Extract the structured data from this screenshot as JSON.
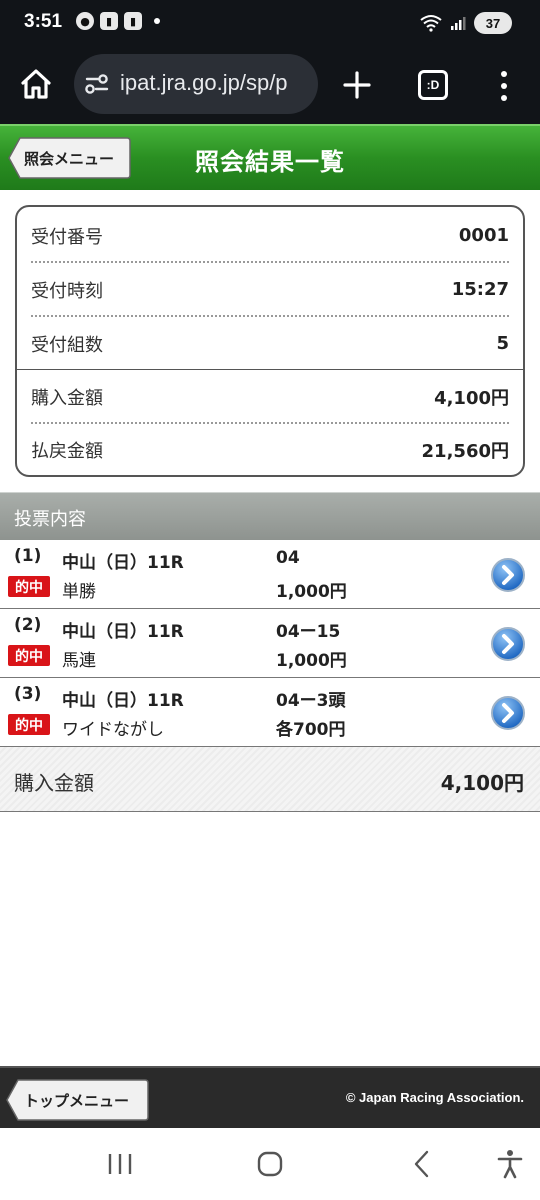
{
  "status_bar": {
    "time": "3:51",
    "battery": "37",
    "notification_icons": [
      "notification-icon",
      "twitch-icon",
      "twitch-icon"
    ]
  },
  "browser": {
    "url": "ipat.jra.go.jp/sp/p",
    "tabs_label": ":D"
  },
  "header": {
    "back_button": "照会メニュー",
    "title": "照会結果一覧",
    "accent_color": "#2a8f22"
  },
  "summary": {
    "rows": [
      {
        "label": "受付番号",
        "value": "0001"
      },
      {
        "label": "受付時刻",
        "value": "15:27"
      },
      {
        "label": "受付組数",
        "value": "5"
      },
      {
        "label": "購入金額",
        "value": "4,100円"
      },
      {
        "label": "払戻金額",
        "value": "21,560円"
      }
    ]
  },
  "votes": {
    "section_title": "投票内容",
    "items": [
      {
        "num": "(1)",
        "badge": "的中",
        "race": "中山（日）11R",
        "bet_type": "単勝",
        "combination": "04",
        "amount": "1,000円"
      },
      {
        "num": "(2)",
        "badge": "的中",
        "race": "中山（日）11R",
        "bet_type": "馬連",
        "combination": "04ー15",
        "amount": "1,000円"
      },
      {
        "num": "(3)",
        "badge": "的中",
        "race": "中山（日）11R",
        "bet_type": "ワイドながし",
        "combination": "04ー3頭",
        "amount": "各700円"
      }
    ],
    "total_label": "購入金額",
    "total_value": "4,100円",
    "badge_color": "#d91418"
  },
  "footer": {
    "top_menu": "トップメニュー",
    "copyright": "© Japan Racing Association."
  }
}
